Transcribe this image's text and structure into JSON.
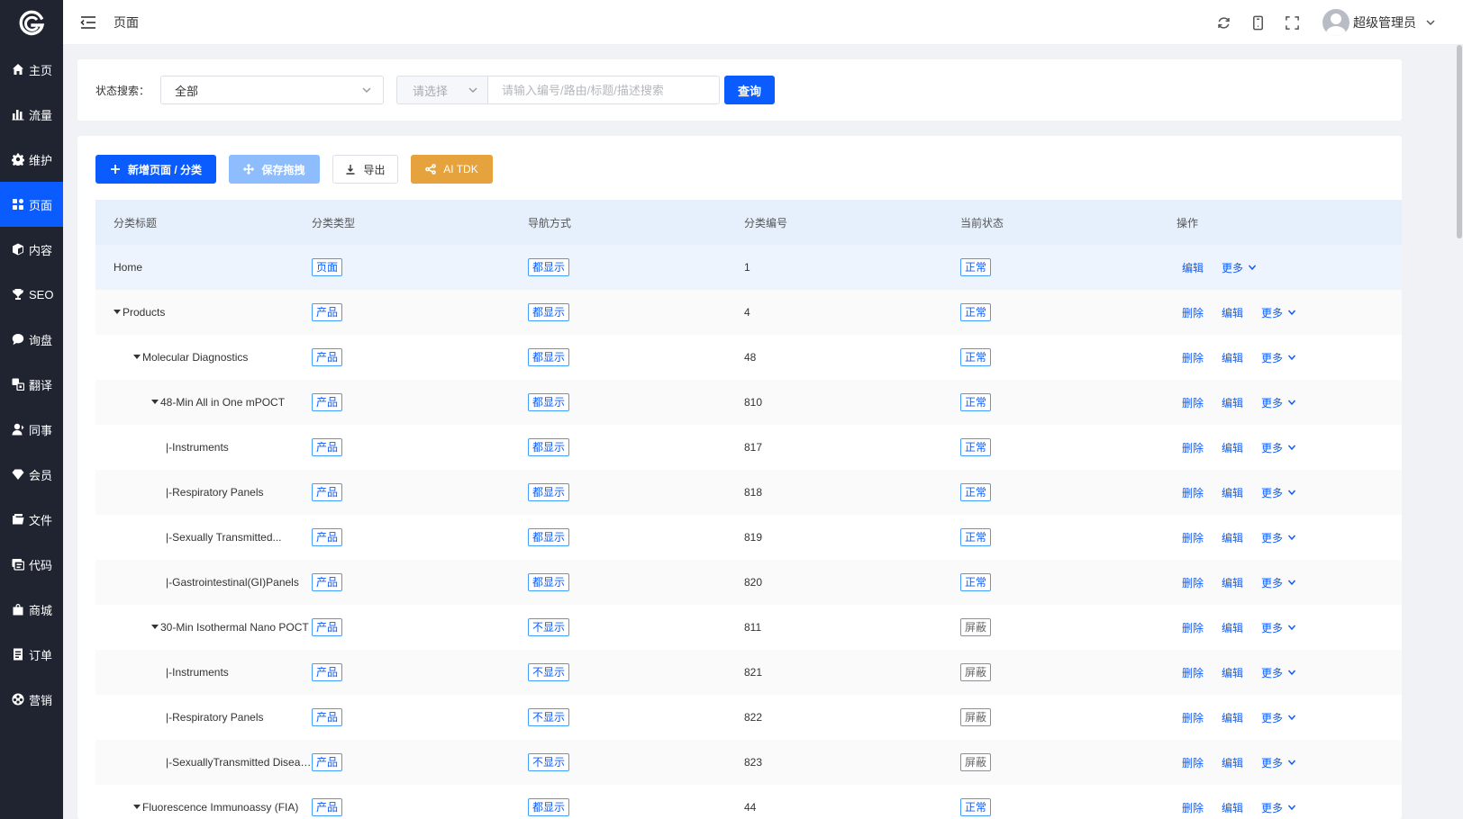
{
  "sidebar": {
    "items": [
      {
        "label": "主页",
        "icon": "home-icon",
        "active": false
      },
      {
        "label": "流量",
        "icon": "bar-chart-icon",
        "active": false
      },
      {
        "label": "维护",
        "icon": "gear-icon",
        "active": false
      },
      {
        "label": "页面",
        "icon": "grid-icon",
        "active": true
      },
      {
        "label": "内容",
        "icon": "cube-icon",
        "active": false
      },
      {
        "label": "SEO",
        "icon": "trophy-icon",
        "active": false
      },
      {
        "label": "询盘",
        "icon": "chat-icon",
        "active": false
      },
      {
        "label": "翻译",
        "icon": "translate-icon",
        "active": false
      },
      {
        "label": "同事",
        "icon": "user-icon",
        "active": false
      },
      {
        "label": "会员",
        "icon": "diamond-icon",
        "active": false
      },
      {
        "label": "文件",
        "icon": "folder-icon",
        "active": false
      },
      {
        "label": "代码",
        "icon": "code-icon",
        "active": false
      },
      {
        "label": "商城",
        "icon": "shop-bag-icon",
        "active": false
      },
      {
        "label": "订单",
        "icon": "order-icon",
        "active": false
      },
      {
        "label": "营销",
        "icon": "marketing-icon",
        "active": false
      }
    ]
  },
  "header": {
    "title": "页面",
    "user_name": "超级管理员"
  },
  "search": {
    "label": "状态搜索：",
    "status_value": "全部",
    "field_select_placeholder": "请选择",
    "input_placeholder": "请输入编号/路由/标题/描述搜索",
    "input_value": "",
    "query_label": "查询"
  },
  "toolbar": {
    "add_label": "新增页面 / 分类",
    "save_label": "保存拖拽",
    "export_label": "导出",
    "ai_label": "AI TDK"
  },
  "table": {
    "columns": [
      "分类标题",
      "分类类型",
      "导航方式",
      "分类编号",
      "当前状态",
      "操作"
    ],
    "rows": [
      {
        "title": "Home",
        "level": 0,
        "expandable": false,
        "type": "页面",
        "nav": "都显示",
        "id": "1",
        "status": "正常",
        "ops": [
          "编辑",
          "更多"
        ]
      },
      {
        "title": "Products",
        "level": 0,
        "expandable": true,
        "type": "产品",
        "nav": "都显示",
        "id": "4",
        "status": "正常",
        "ops": [
          "删除",
          "编辑",
          "更多"
        ]
      },
      {
        "title": "Molecular Diagnostics",
        "level": 1,
        "expandable": true,
        "type": "产品",
        "nav": "都显示",
        "id": "48",
        "status": "正常",
        "ops": [
          "删除",
          "编辑",
          "更多"
        ]
      },
      {
        "title": "48-Min All in One mPOCT",
        "level": 2,
        "expandable": true,
        "type": "产品",
        "nav": "都显示",
        "id": "810",
        "status": "正常",
        "ops": [
          "删除",
          "编辑",
          "更多"
        ]
      },
      {
        "title": "|-Instruments",
        "level": 3,
        "expandable": false,
        "type": "产品",
        "nav": "都显示",
        "id": "817",
        "status": "正常",
        "ops": [
          "删除",
          "编辑",
          "更多"
        ]
      },
      {
        "title": "|-Respiratory Panels",
        "level": 3,
        "expandable": false,
        "type": "产品",
        "nav": "都显示",
        "id": "818",
        "status": "正常",
        "ops": [
          "删除",
          "编辑",
          "更多"
        ]
      },
      {
        "title": "|-Sexually Transmitted...",
        "level": 3,
        "expandable": false,
        "type": "产品",
        "nav": "都显示",
        "id": "819",
        "status": "正常",
        "ops": [
          "删除",
          "编辑",
          "更多"
        ]
      },
      {
        "title": "|-Gastrointestinal(GI)Panels",
        "level": 3,
        "expandable": false,
        "type": "产品",
        "nav": "都显示",
        "id": "820",
        "status": "正常",
        "ops": [
          "删除",
          "编辑",
          "更多"
        ]
      },
      {
        "title": "30-Min Isothermal Nano POCT",
        "level": 2,
        "expandable": true,
        "type": "产品",
        "nav": "不显示",
        "id": "811",
        "status": "屏蔽",
        "ops": [
          "删除",
          "编辑",
          "更多"
        ]
      },
      {
        "title": "|-Instruments",
        "level": 3,
        "expandable": false,
        "type": "产品",
        "nav": "不显示",
        "id": "821",
        "status": "屏蔽",
        "ops": [
          "删除",
          "编辑",
          "更多"
        ]
      },
      {
        "title": "|-Respiratory Panels",
        "level": 3,
        "expandable": false,
        "type": "产品",
        "nav": "不显示",
        "id": "822",
        "status": "屏蔽",
        "ops": [
          "删除",
          "编辑",
          "更多"
        ]
      },
      {
        "title": "|-SexuallyTransmitted Disease...",
        "level": 3,
        "expandable": false,
        "type": "产品",
        "nav": "不显示",
        "id": "823",
        "status": "屏蔽",
        "ops": [
          "删除",
          "编辑",
          "更多"
        ]
      },
      {
        "title": "Fluorescence Immunoassy (FIA)",
        "level": 1,
        "expandable": true,
        "type": "产品",
        "nav": "都显示",
        "id": "44",
        "status": "正常",
        "ops": [
          "删除",
          "编辑",
          "更多"
        ]
      }
    ]
  },
  "colors": {
    "primary": "#0b5cff",
    "sidebar_bg": "#1f2430",
    "warning": "#e6a23c",
    "header_row_bg": "#e6f0fd"
  }
}
